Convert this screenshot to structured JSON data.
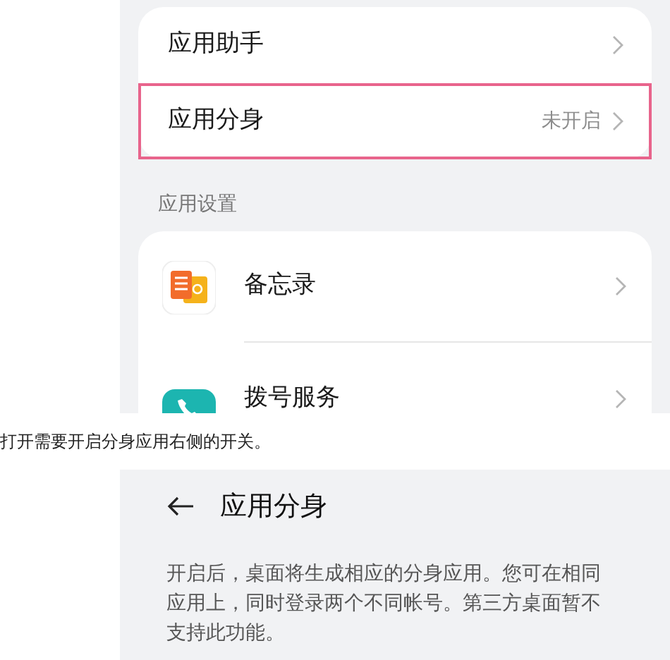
{
  "settings_screenshot": {
    "rows": [
      {
        "label": "应用助手",
        "highlighted": false
      },
      {
        "label": "应用分身",
        "value": "未开启",
        "highlighted": true
      }
    ],
    "section_label": "应用设置",
    "apps": [
      {
        "name": "备忘录",
        "kind": "notes"
      },
      {
        "name": "拨号服务",
        "kind": "phone"
      }
    ]
  },
  "caption": "打开需要开启分身应用右侧的开关。",
  "detail_screenshot": {
    "title": "应用分身",
    "description": "开启后，桌面将生成相应的分身应用。您可在相同应用上，同时登录两个不同帐号。第三方桌面暂不支持此功能。"
  }
}
